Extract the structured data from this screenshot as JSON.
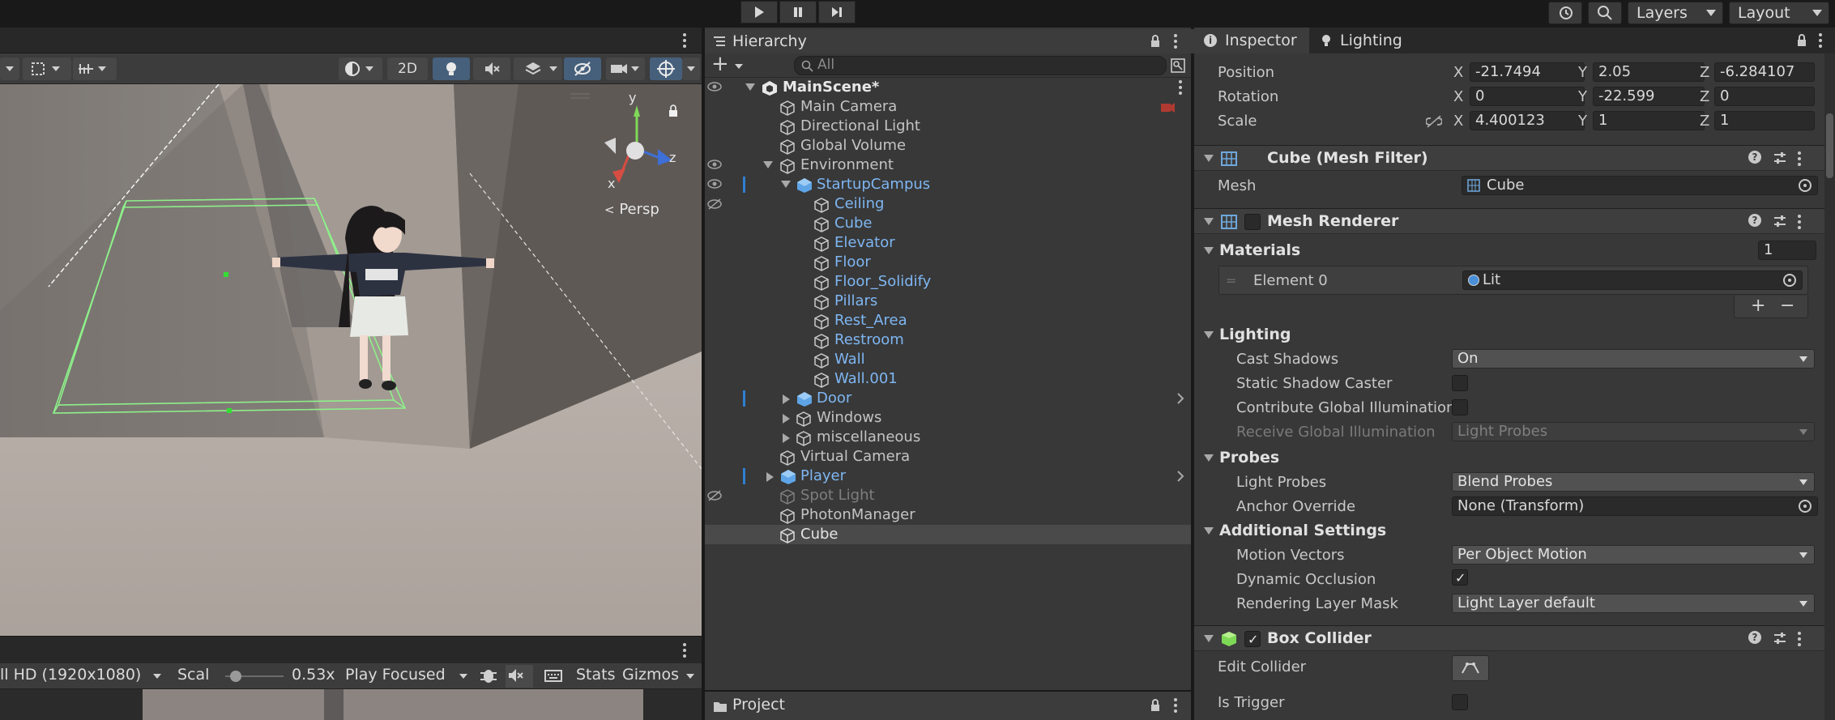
{
  "toolbar": {
    "play_label": "Play",
    "pause_label": "Pause",
    "step_label": "Step",
    "layers_label": "Layers",
    "layout_label": "Layout"
  },
  "scene": {
    "mode_2d": "2D",
    "persp_label": "Persp",
    "gizmo_axes": {
      "y": "y",
      "x": "x",
      "z": "z"
    }
  },
  "game": {
    "resolution": "ll HD (1920x1080)",
    "scale_label": "Scal",
    "scale_value": "0.53x",
    "play_focused": "Play Focused",
    "stats_label": "Stats",
    "gizmos_label": "Gizmos",
    "scale_fraction": 0.1
  },
  "hierarchy": {
    "title": "Hierarchy",
    "search_placeholder": "All",
    "scene_name": "MainScene*",
    "items": [
      {
        "label": "Main Camera"
      },
      {
        "label": "Directional Light"
      },
      {
        "label": "Global Volume"
      },
      {
        "label": "Environment"
      },
      {
        "label": "StartupCampus"
      },
      {
        "label": "Ceiling"
      },
      {
        "label": "Cube"
      },
      {
        "label": "Elevator"
      },
      {
        "label": "Floor"
      },
      {
        "label": "Floor_Solidify"
      },
      {
        "label": "Pillars"
      },
      {
        "label": "Rest_Area"
      },
      {
        "label": "Restroom"
      },
      {
        "label": "Wall"
      },
      {
        "label": "Wall.001"
      },
      {
        "label": "Door"
      },
      {
        "label": "Windows"
      },
      {
        "label": "miscellaneous"
      },
      {
        "label": "Virtual Camera"
      },
      {
        "label": "Player"
      },
      {
        "label": "Spot Light"
      },
      {
        "label": "PhotonManager"
      },
      {
        "label": "Cube"
      }
    ]
  },
  "project": {
    "title": "Project"
  },
  "inspector": {
    "tab_inspector": "Inspector",
    "tab_lighting": "Lighting",
    "transform": {
      "position_label": "Position",
      "rotation_label": "Rotation",
      "scale_label": "Scale",
      "axis_x": "X",
      "axis_y": "Y",
      "axis_z": "Z",
      "position": {
        "x": "-21.7494",
        "y": "2.05",
        "z": "-6.284107"
      },
      "rotation": {
        "x": "0",
        "y": "-22.599",
        "z": "0"
      },
      "scale": {
        "x": "4.400123",
        "y": "1",
        "z": "1"
      }
    },
    "mesh_filter": {
      "title": "Cube (Mesh Filter)",
      "mesh_label": "Mesh",
      "mesh_value": "Cube"
    },
    "mesh_renderer": {
      "title": "Mesh Renderer",
      "materials_label": "Materials",
      "materials_count": "1",
      "element0_label": "Element 0",
      "element0_value": "Lit",
      "plus": "+",
      "minus": "−",
      "lighting_label": "Lighting",
      "cast_shadows_label": "Cast Shadows",
      "cast_shadows_value": "On",
      "static_shadow_label": "Static Shadow Caster",
      "contribute_gi_label": "Contribute Global Illumination",
      "receive_gi_label": "Receive Global Illumination",
      "receive_gi_value": "Light Probes",
      "probes_label": "Probes",
      "light_probes_label": "Light Probes",
      "light_probes_value": "Blend Probes",
      "anchor_override_label": "Anchor Override",
      "anchor_override_value": "None (Transform)",
      "additional_label": "Additional Settings",
      "motion_vectors_label": "Motion Vectors",
      "motion_vectors_value": "Per Object Motion",
      "dynamic_occlusion_label": "Dynamic Occlusion",
      "rendering_layer_label": "Rendering Layer Mask",
      "rendering_layer_value": "Light Layer default"
    },
    "box_collider": {
      "title": "Box Collider",
      "edit_collider_label": "Edit Collider",
      "is_trigger_label": "Is Trigger"
    }
  },
  "colors": {
    "selection_blue": "#2f7fd1",
    "prefab_blue": "#7eb6f2",
    "panel_bg": "#383838",
    "collider_green": "#8ef08a"
  }
}
